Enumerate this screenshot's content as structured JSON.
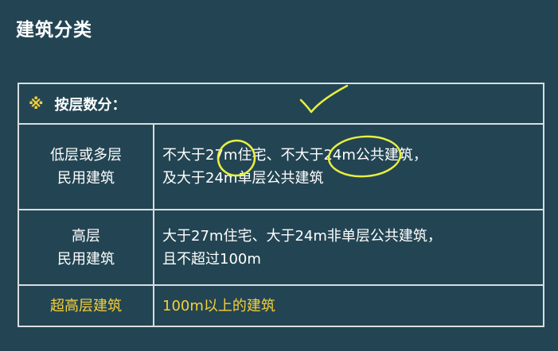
{
  "page": {
    "title": "建筑分类"
  },
  "table": {
    "header": {
      "mark": "※",
      "label": "按层数分："
    },
    "rows": [
      {
        "category_lines": [
          "低层或多层",
          "民用建筑"
        ],
        "description_lines": [
          "不大于27m住宅、不大于24m公共建筑，",
          "及大于24m单层公共建筑"
        ]
      },
      {
        "category_lines": [
          "高层",
          "民用建筑"
        ],
        "description_lines": [
          "大于27m住宅、大于24m非单层公共建筑，",
          "且不超过100m"
        ]
      },
      {
        "category_lines": [
          "超高层建筑"
        ],
        "description_lines": [
          "100m以上的建筑"
        ]
      }
    ]
  },
  "colors": {
    "background": "#234553",
    "border": "#d9dde0",
    "highlight": "#f5cf3a",
    "annotation": "#e8f040"
  },
  "annotations": {
    "checkmark": "checkmark-icon",
    "circles": [
      "circle-27m",
      "circle-24m"
    ]
  }
}
